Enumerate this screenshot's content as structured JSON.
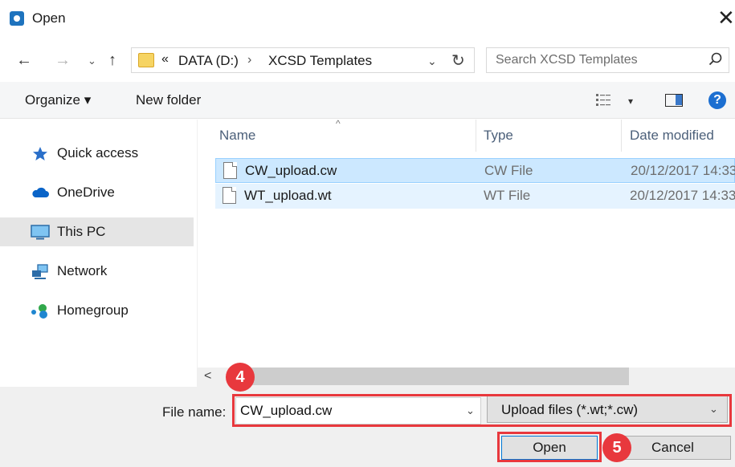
{
  "window": {
    "title": "Open",
    "close_glyph": "✕"
  },
  "nav": {
    "back": "←",
    "forward": "→",
    "recent": "⌄",
    "up": "↑"
  },
  "address": {
    "overflow": "«",
    "crumbs": [
      "DATA (D:)",
      "XCSD Templates"
    ],
    "separator": "›",
    "dropdown": "⌄",
    "refresh": "↻"
  },
  "search": {
    "placeholder": "Search XCSD Templates",
    "value": ""
  },
  "toolbar": {
    "organize_label": "Organize ▾",
    "new_folder_label": "New folder",
    "views_dropdown": "▾",
    "help": "?"
  },
  "sidebar": {
    "items": [
      {
        "label": "Quick access",
        "icon": "star-icon"
      },
      {
        "label": "OneDrive",
        "icon": "cloud-icon"
      },
      {
        "label": "This PC",
        "icon": "monitor-icon"
      },
      {
        "label": "Network",
        "icon": "network-icon"
      },
      {
        "label": "Homegroup",
        "icon": "homegroup-icon"
      }
    ],
    "selected_index": 2
  },
  "files": {
    "columns": {
      "name": "Name",
      "type": "Type",
      "date": "Date modified",
      "sort_caret": "^"
    },
    "rows": [
      {
        "name": "CW_upload.cw",
        "type": "CW File",
        "date": "20/12/2017 14:33"
      },
      {
        "name": "WT_upload.wt",
        "type": "WT File",
        "date": "20/12/2017 14:33"
      }
    ],
    "scroll_left": "<"
  },
  "bottom": {
    "file_name_label": "File name:",
    "file_name_value": "CW_upload.cw",
    "file_type_value": "Upload files (*.wt;*.cw)",
    "dropdown": "⌄",
    "open_label": "Open",
    "cancel_label": "Cancel"
  },
  "annotations": {
    "step_a": "4",
    "step_b": "5"
  },
  "colors": {
    "accent": "#0078d7",
    "highlight": "#e8383d",
    "selection": "#cce8ff"
  }
}
